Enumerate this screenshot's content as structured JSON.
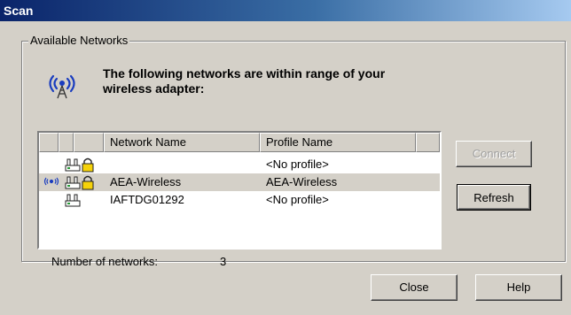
{
  "window": {
    "title": "Scan"
  },
  "group": {
    "legend": "Available Networks",
    "header_line1": "The following networks are within range of your",
    "header_line2": "wireless adapter:"
  },
  "list": {
    "columns": [
      "",
      "",
      "",
      "Network Name",
      "Profile Name",
      ""
    ],
    "rows": [
      {
        "name": "",
        "profile": "<No profile>",
        "connected": false,
        "secured": true,
        "selected": false
      },
      {
        "name": "AEA-Wireless",
        "profile": "AEA-Wireless",
        "connected": true,
        "secured": true,
        "selected": true
      },
      {
        "name": "IAFTDG01292",
        "profile": "<No profile>",
        "connected": false,
        "secured": false,
        "selected": false
      }
    ]
  },
  "buttons": {
    "connect": "Connect",
    "refresh": "Refresh",
    "close": "Close",
    "help": "Help"
  },
  "status": {
    "count_label": "Number of networks:",
    "count_value": "3"
  },
  "icons": {
    "header": "wireless-signal-icon",
    "row_network": "network-computer-icon",
    "row_lock": "padlock-icon",
    "row_signal": "wireless-signal-small-icon"
  },
  "colors": {
    "title_start": "#0a246a",
    "title_end": "#a6caf0",
    "face": "#d4d0c8",
    "icon_blue": "#1a3dbf",
    "lock_yellow": "#f5d20a"
  }
}
